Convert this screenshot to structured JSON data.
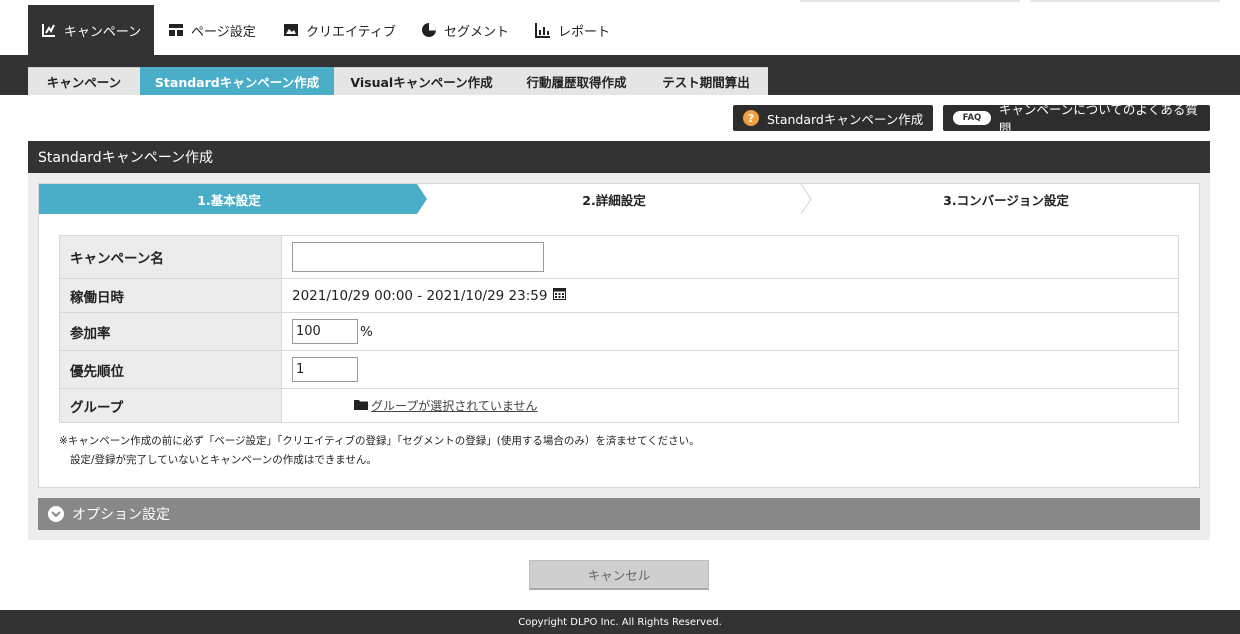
{
  "topnav": {
    "items": [
      {
        "label": "キャンペーン",
        "icon": "campaign-chart-icon",
        "active": true
      },
      {
        "label": "ページ設定",
        "icon": "layout-icon"
      },
      {
        "label": "クリエイティブ",
        "icon": "image-icon"
      },
      {
        "label": "セグメント",
        "icon": "pie-chart-icon"
      },
      {
        "label": "レポート",
        "icon": "bar-chart-icon"
      }
    ]
  },
  "subtabs": [
    {
      "label": "キャンペーン"
    },
    {
      "label": "Standardキャンペーン作成",
      "active": true
    },
    {
      "label": "Visualキャンペーン作成"
    },
    {
      "label": "行動履歴取得作成"
    },
    {
      "label": "テスト期間算出"
    }
  ],
  "actions": {
    "help_label": "Standardキャンペーン作成",
    "help_icon": "?",
    "faq_badge": "FAQ",
    "faq_label": "キャンペーンについてのよくある質問"
  },
  "section": {
    "title": "Standardキャンペーン作成"
  },
  "steps": [
    {
      "label": "1.基本設定",
      "active": true
    },
    {
      "label": "2.詳細設定"
    },
    {
      "label": "3.コンバージョン設定"
    }
  ],
  "form": {
    "name_label": "キャンペーン名",
    "name_value": "",
    "period_label": "稼働日時",
    "period_value": "2021/10/29 00:00 - 2021/10/29 23:59",
    "rate_label": "参加率",
    "rate_value": "100",
    "rate_unit": "%",
    "priority_label": "優先順位",
    "priority_value": "1",
    "group_label": "グループ",
    "group_link": "グループが選択されていません"
  },
  "notes": {
    "line1": "※キャンペーン作成の前に必ず「ページ設定」「クリエイティブの登録」「セグメントの登録」(使用する場合のみ）を済ませてください。",
    "line2": "設定/登録が完了していないとキャンペーンの作成はできません。"
  },
  "options": {
    "label": "オプション設定"
  },
  "cancel_label": "キャンセル",
  "footer": {
    "copyright": "Copyright DLPO Inc. All Rights Reserved."
  },
  "colors": {
    "accent": "#4aaec8",
    "dark": "#333333",
    "option_bar": "#888888"
  }
}
